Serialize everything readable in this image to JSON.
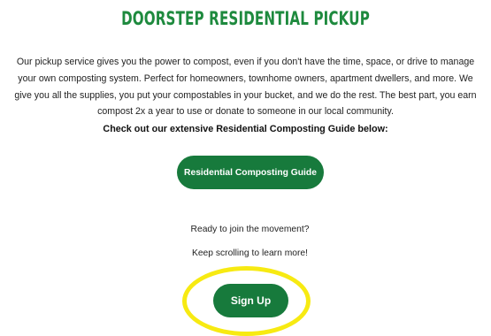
{
  "page": {
    "headline": "DOORSTEP RESIDENTIAL PICKUP",
    "intro_text": "Our pickup service gives you the power to compost, even if you don't have the time, space, or drive to manage your own composting system. Perfect for homeowners, townhome owners, apartment dwellers, and more. We give you all the supplies, you put your compostables in your bucket, and we do the rest. The best part, you earn compost 2x a year to use or donate to someone in our local community.",
    "guide_heading": "Check out our extensive  Residential Composting Guide below:",
    "guide_button_label": "Residential Composting Guide",
    "ready_text": "Ready to join the movement?",
    "scroll_text": "Keep scrolling to learn more!",
    "signup_button_label": "Sign Up"
  },
  "colors": {
    "headline_green": "#1e8a3e",
    "button_green": "#177a3c",
    "highlight_yellow": "#f7ea12",
    "background": "#ffffff"
  }
}
